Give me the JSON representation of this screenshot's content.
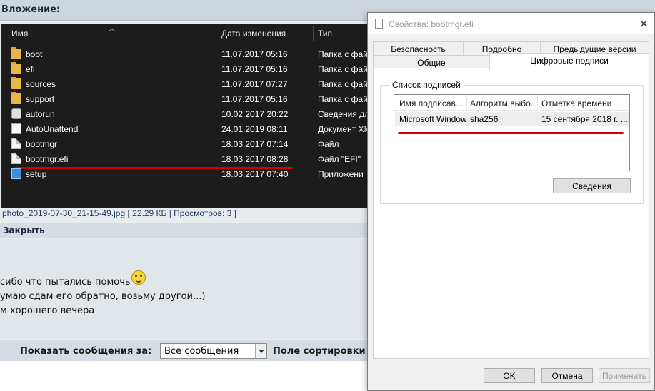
{
  "attachment_header": "Вложение:",
  "explorer": {
    "columns": {
      "name": "Имя",
      "date": "Дата изменения",
      "type": "Тип"
    },
    "rows": [
      {
        "name": "boot",
        "date": "11.07.2017 05:16",
        "type": "Папка с фай",
        "icon": "folder-icon"
      },
      {
        "name": "efi",
        "date": "11.07.2017 05:16",
        "type": "Папка с фай",
        "icon": "folder-icon"
      },
      {
        "name": "sources",
        "date": "11.07.2017 07:27",
        "type": "Папка с фай",
        "icon": "folder-icon"
      },
      {
        "name": "support",
        "date": "11.07.2017 05:16",
        "type": "Папка с фай",
        "icon": "folder-icon"
      },
      {
        "name": "autorun",
        "date": "10.02.2017 20:22",
        "type": "Сведения дл",
        "icon": "settings-file-icon"
      },
      {
        "name": "AutoUnattend",
        "date": "24.01.2019 08:11",
        "type": "Документ XM",
        "icon": "xml-file-icon"
      },
      {
        "name": "bootmgr",
        "date": "18.03.2017 07:14",
        "type": "Файл",
        "icon": "file-icon"
      },
      {
        "name": "bootmgr.efi",
        "date": "18.03.2017 08:28",
        "type": "Файл \"EFI\"",
        "icon": "file-icon"
      },
      {
        "name": "setup",
        "date": "18.03.2017 07:40",
        "type": "Приложени",
        "icon": "setup-icon"
      }
    ]
  },
  "caption": "photo_2019-07-30_21-15-49.jpg [ 22.29 КБ | Просмотров: 3 ]",
  "close_label": "Закрыть",
  "message_lines": [
    "сибо что пытались помочь",
    "умаю сдам его обратно, возьму другой...)",
    "м хорошего вечера"
  ],
  "bottom_bar": {
    "show_label": "Показать сообщения за:",
    "select_value": "Все сообщения",
    "sort_label": "Поле сортировки"
  },
  "dialog": {
    "title": "Свойства: bootmgr.efi",
    "tabs_row1": [
      "Безопасность",
      "Подробно",
      "Предыдущие версии"
    ],
    "tabs_row2": [
      "Общие",
      "Цифровые подписи"
    ],
    "group_label": "Список подписей",
    "list_columns": [
      "Имя подписав...",
      "Алгоритм выбо...",
      "Отметка времени"
    ],
    "list_row": [
      "Microsoft Windows",
      "sha256",
      "15 сентября 2018 г. ..."
    ],
    "details_button": "Сведения",
    "ok_button": "OK",
    "cancel_button": "Отмена",
    "apply_button": "Применить"
  },
  "colors": {
    "highlight_underline": "#d40000",
    "explorer_bg": "#1c1c1c"
  }
}
